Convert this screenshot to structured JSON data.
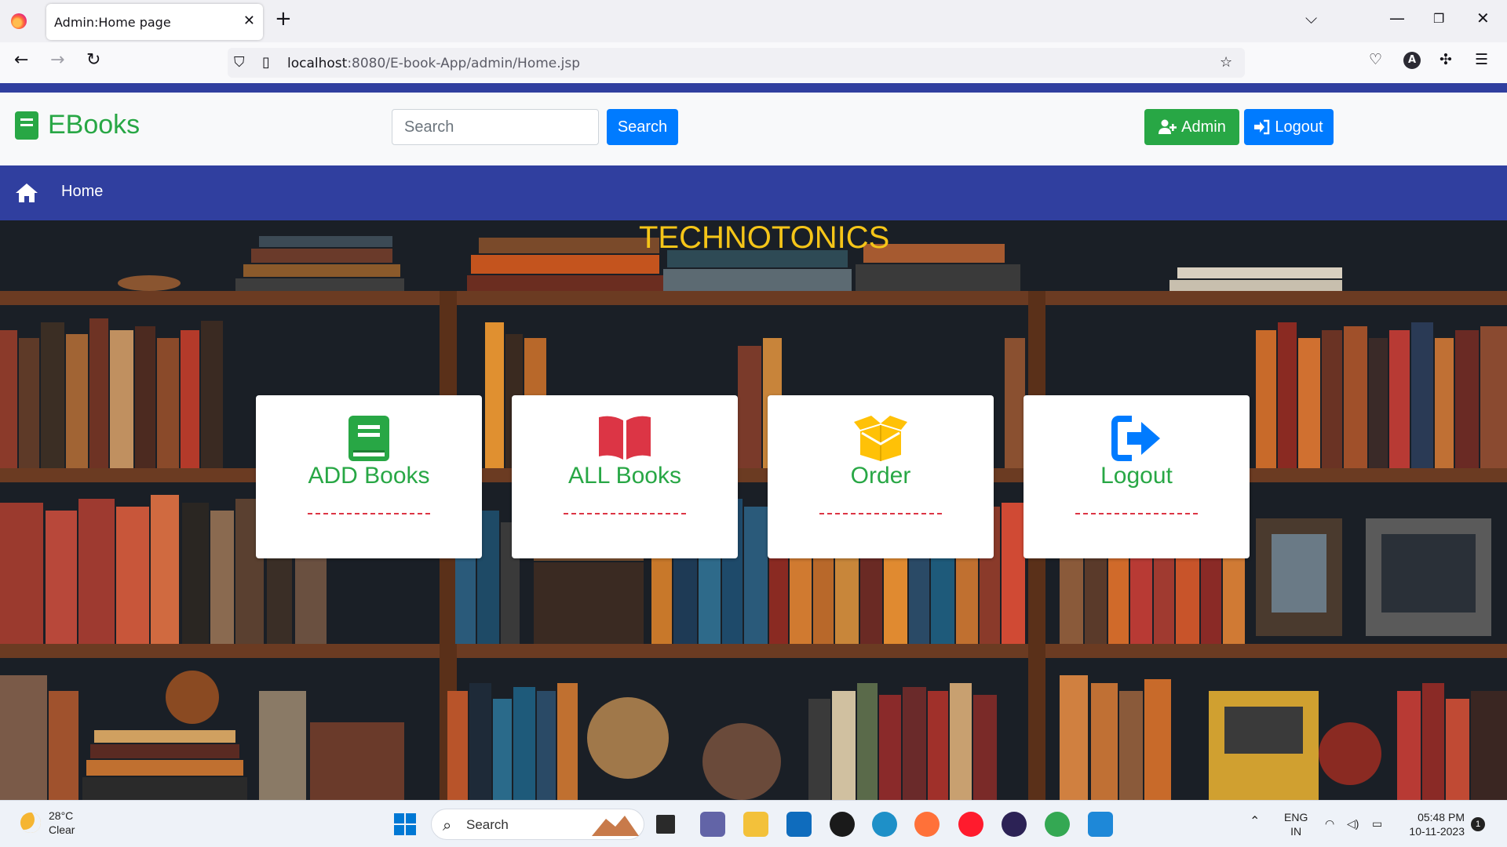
{
  "browser": {
    "tab_title": "Admin:Home page",
    "url_host": "localhost",
    "url_path": ":8080/E-book-App/admin/Home.jsp",
    "account_initial": "A"
  },
  "header": {
    "brand": "EBooks",
    "search_placeholder": "Search",
    "search_button": "Search",
    "admin_button": "Admin",
    "logout_button": "Logout"
  },
  "menu": {
    "home_label": "Home"
  },
  "hero": {
    "title": "TECHNOTONICS"
  },
  "cards": [
    {
      "label": "ADD Books",
      "icon": "book-icon",
      "color": "#28a745"
    },
    {
      "label": "ALL Books",
      "icon": "open-book-icon",
      "color": "#dc3545"
    },
    {
      "label": "Order",
      "icon": "box-open-icon",
      "color": "#ffc107"
    },
    {
      "label": "Logout",
      "icon": "sign-out-icon",
      "color": "#007bff"
    }
  ],
  "taskbar": {
    "temperature": "28°C",
    "weather": "Clear",
    "search_label": "Search",
    "language_1": "ENG",
    "language_2": "IN",
    "time": "05:48 PM",
    "date": "10-11-2023",
    "notification_count": "1"
  },
  "colors": {
    "primary": "#007bff",
    "success": "#28a745",
    "navbar": "#303f9f",
    "title": "#f5c518"
  }
}
